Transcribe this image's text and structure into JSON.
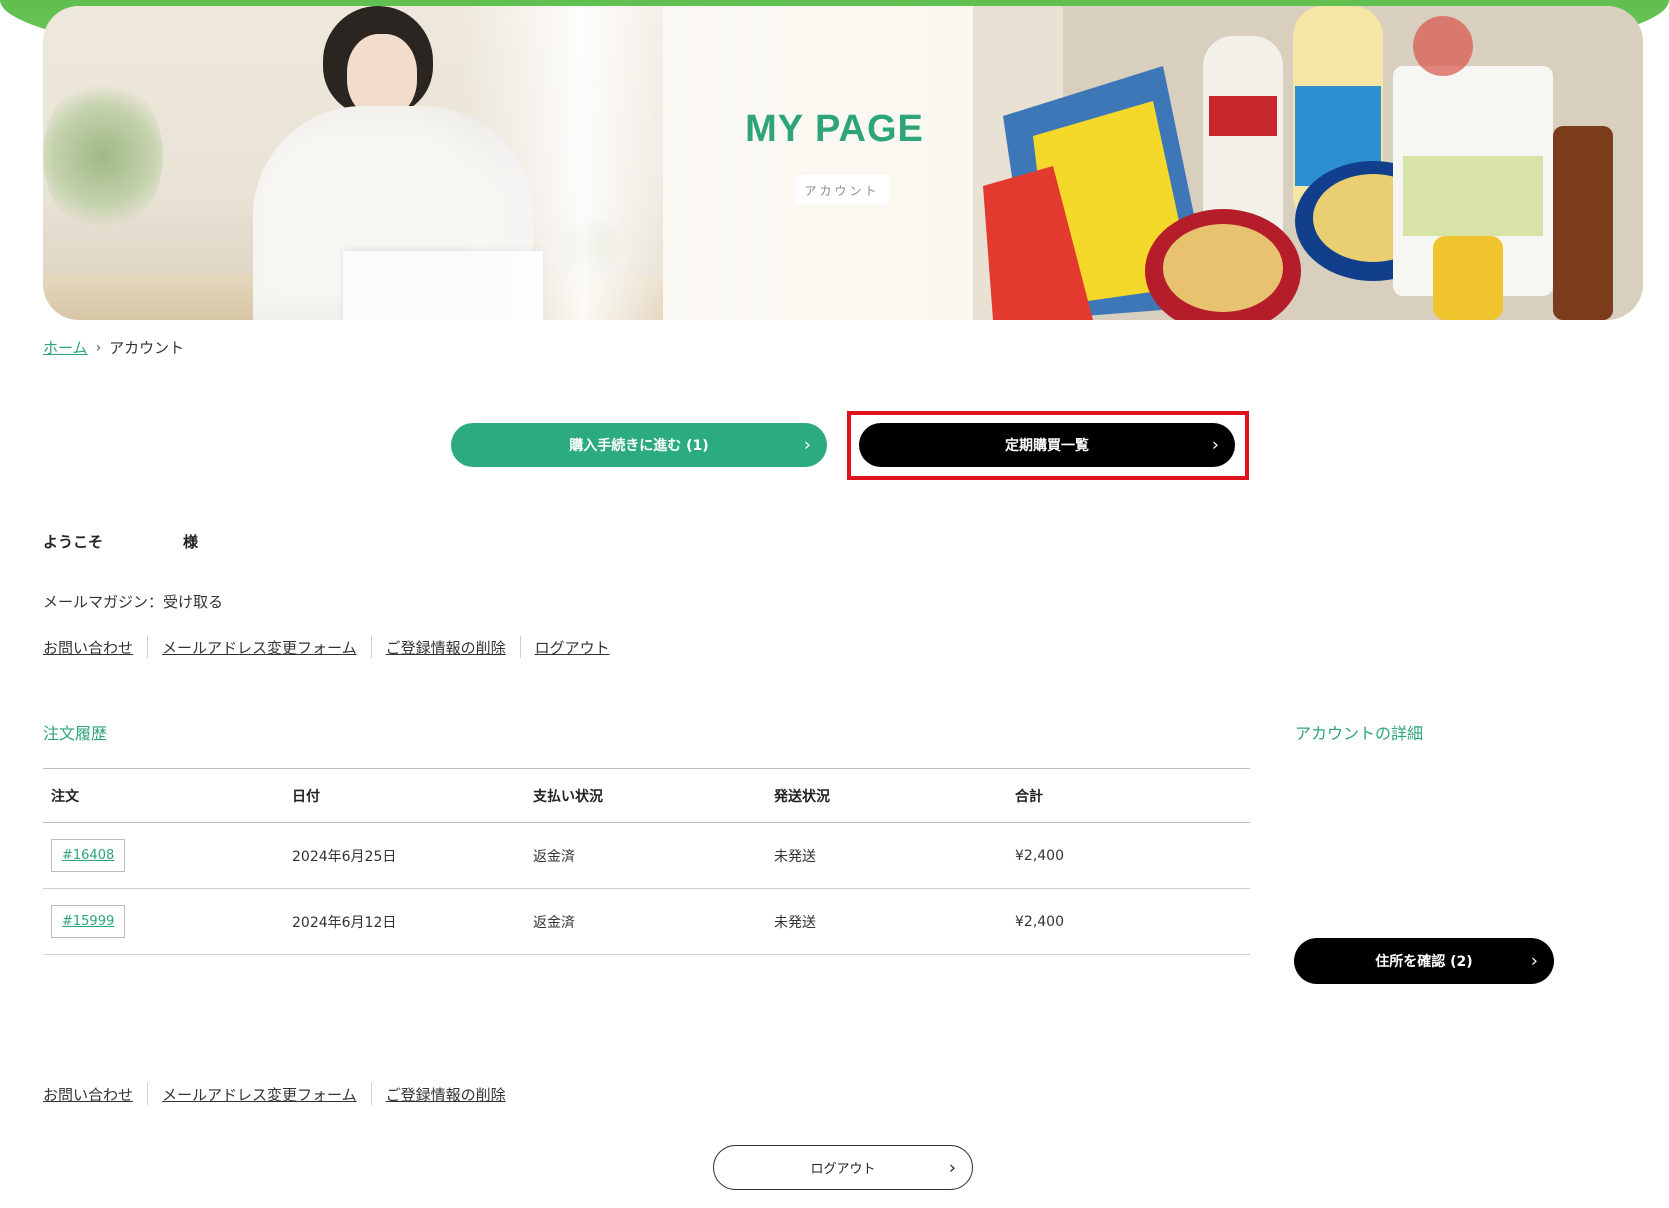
{
  "hero": {
    "title": "MY PAGE",
    "subtitle": "アカウント"
  },
  "breadcrumb": {
    "home": "ホーム",
    "current": "アカウント"
  },
  "actions": {
    "checkout_label": "購入手続きに進む (1)",
    "subscription_label": "定期購買一覧",
    "highlight_color": "#e0121c"
  },
  "welcome": {
    "prefix": "ようこそ",
    "suffix": "様"
  },
  "magazine": "メールマガジン：受け取る",
  "links": {
    "contact": "お問い合わせ",
    "email_change": "メールアドレス変更フォーム",
    "delete": "ご登録情報の削除",
    "logout": "ログアウト"
  },
  "orders": {
    "title": "注文履歴",
    "columns": [
      "注文",
      "日付",
      "支払い状況",
      "発送状況",
      "合計"
    ],
    "rows": [
      [
        "#16408",
        "2024年6月25日",
        "返金済",
        "未発送",
        "¥2,400"
      ],
      [
        "#15999",
        "2024年6月12日",
        "返金済",
        "未発送",
        "¥2,400"
      ]
    ]
  },
  "account": {
    "title": "アカウントの詳細",
    "address_button": "住所を確認 (2)"
  },
  "footer": {
    "logout_button": "ログアウト"
  },
  "colors": {
    "brand_green": "#2ea47a",
    "button_green": "#2cac7e",
    "button_black": "#000000"
  }
}
